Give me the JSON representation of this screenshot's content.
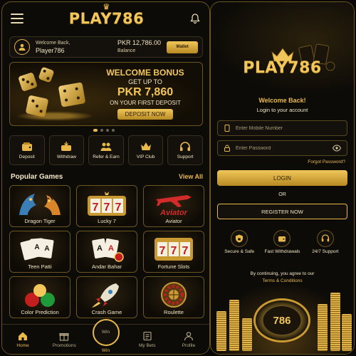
{
  "left": {
    "header": {
      "logo": "PLAY786"
    },
    "user": {
      "greeting": "Welcome Back,",
      "name": "Player786",
      "balance": "PKR 12,786.00",
      "balance_label": "Balance",
      "wallet_label": "Wallet"
    },
    "banner": {
      "line1": "WELCOME BONUS",
      "line2": "GET UP TO",
      "amount": "PKR 7,860",
      "line3": "ON YOUR FIRST DEPOSIT",
      "cta": "DEPOSIT NOW",
      "slides": 4,
      "active_slide": 1
    },
    "actions": [
      {
        "label": "Deposit",
        "icon": "wallet-icon"
      },
      {
        "label": "Withdraw",
        "icon": "withdraw-icon"
      },
      {
        "label": "Refer & Earn",
        "icon": "people-icon"
      },
      {
        "label": "VIP Club",
        "icon": "crown-icon"
      },
      {
        "label": "Support",
        "icon": "headset-icon"
      }
    ],
    "popular": {
      "title": "Popular Games",
      "view_all": "View All"
    },
    "games": [
      {
        "name": "Dragon Tiger",
        "icon": "dragon-tiger-icon"
      },
      {
        "name": "Lucky 7",
        "icon": "slot-777-icon"
      },
      {
        "name": "Aviator",
        "icon": "plane-icon"
      },
      {
        "name": "Teen Patti",
        "icon": "cards-icon"
      },
      {
        "name": "Andar Bahar",
        "icon": "cards-icon"
      },
      {
        "name": "Fortune Slots",
        "icon": "slot-777-icon"
      },
      {
        "name": "Color Prediction",
        "icon": "balls-icon"
      },
      {
        "name": "Crash Game",
        "icon": "rocket-icon"
      },
      {
        "name": "Roulette",
        "icon": "roulette-icon"
      }
    ],
    "nav": [
      {
        "label": "Home",
        "icon": "home-icon",
        "active": true
      },
      {
        "label": "Promotions",
        "icon": "gift-icon"
      },
      {
        "label": "Win",
        "icon": "win-icon",
        "center": true
      },
      {
        "label": "My Bets",
        "icon": "ticket-icon"
      },
      {
        "label": "Profile",
        "icon": "user-icon"
      }
    ],
    "nav_center_text": "Win"
  },
  "right": {
    "logo": "PLAY786",
    "welcome": "Welcome Back!",
    "subtitle": "Login to your account",
    "mobile_placeholder": "Enter Mobile Number",
    "password_placeholder": "Enter Password",
    "forgot": "Forgot Password?",
    "login": "LOGIN",
    "or": "OR",
    "register": "REGISTER NOW",
    "features": [
      {
        "label": "Secure & Safe",
        "icon": "shield-lock-icon"
      },
      {
        "label": "Fast Withdrawals",
        "icon": "wallet-icon"
      },
      {
        "label": "24/7 Support",
        "icon": "headset-icon"
      }
    ],
    "terms_prefix": "By continuing, you agree to our",
    "terms_link": "Terms & Conditions",
    "chip_text": "786"
  },
  "colors": {
    "gold": "#e8b84a",
    "background": "#0d0b08",
    "border": "#6b5520"
  }
}
